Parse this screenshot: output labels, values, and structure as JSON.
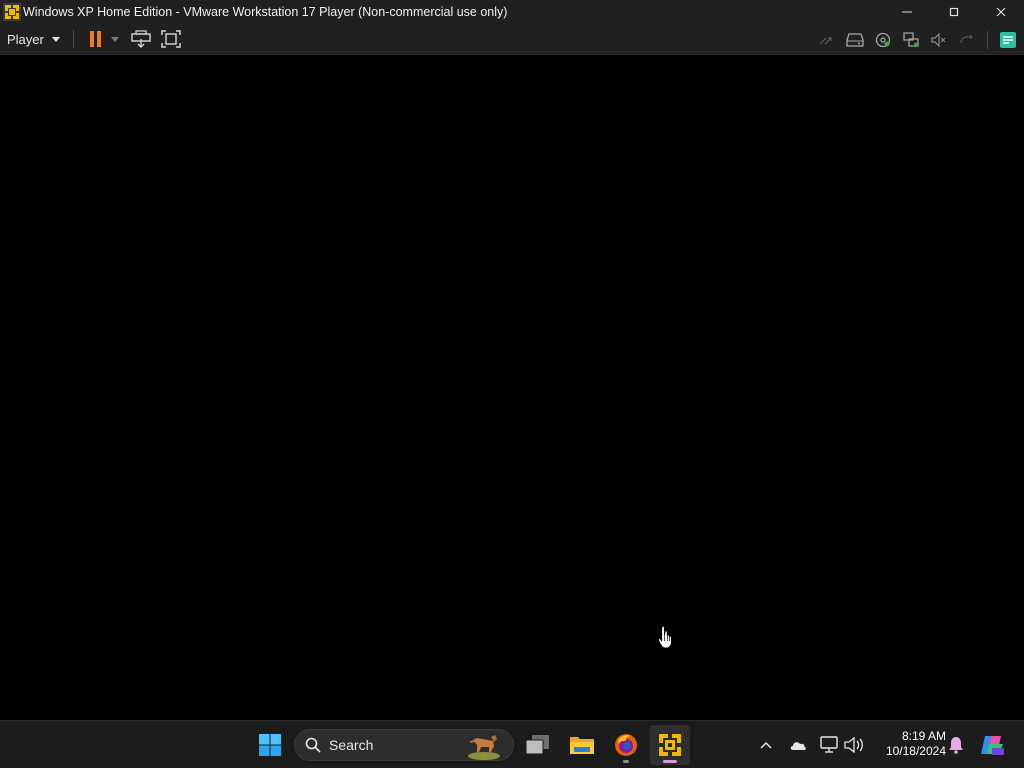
{
  "window": {
    "title": "Windows XP Home Edition - VMware Workstation 17 Player (Non-commercial use only)"
  },
  "toolbar": {
    "player_menu_label": "Player"
  },
  "taskbar": {
    "search_label": "Search"
  },
  "tray": {
    "time": "8:19 AM",
    "date": "10/18/2024"
  },
  "colors": {
    "pause_orange": "#f07c1e",
    "vmware_yellow": "#f2b705",
    "titlebar_bg": "#202020",
    "taskbar_bg": "#1c1c1c"
  },
  "icons": {
    "titlebar": [
      "vmware-icon",
      "minimize-icon",
      "maximize-icon",
      "close-icon"
    ],
    "toolbar": [
      "pause-icon",
      "send-ctrl-alt-del-icon",
      "fullscreen-icon",
      "fast-forward-icon",
      "hard-disk-icon",
      "cd-dvd-icon",
      "network-icon",
      "sound-icon",
      "usb-icon",
      "notes-icon"
    ],
    "taskbar": [
      "windows-start-icon",
      "search-icon",
      "task-view-icon",
      "file-explorer-icon",
      "firefox-icon",
      "vmware-player-icon"
    ],
    "tray": [
      "chevron-up-icon",
      "onedrive-icon",
      "network-icon",
      "volume-icon",
      "notification-bell-icon",
      "copilot-icon"
    ]
  }
}
